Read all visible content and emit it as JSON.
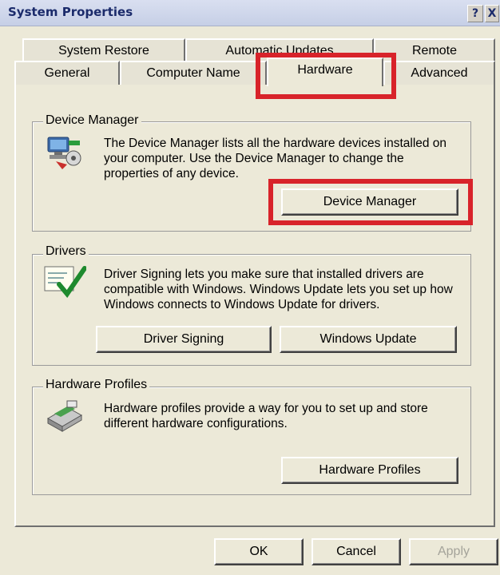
{
  "window": {
    "title": "System Properties",
    "help_btn": "?",
    "close_btn": "X"
  },
  "tabs": {
    "row1": [
      "System Restore",
      "Automatic Updates",
      "Remote"
    ],
    "row2": [
      "General",
      "Computer Name",
      "Hardware",
      "Advanced"
    ],
    "active": "Hardware"
  },
  "device_manager": {
    "title": "Device Manager",
    "desc": "The Device Manager lists all the hardware devices installed on your computer. Use the Device Manager to change the properties of any device.",
    "button": "Device Manager",
    "icon": "device-manager-icon"
  },
  "drivers": {
    "title": "Drivers",
    "desc": "Driver Signing lets you make sure that installed drivers are compatible with Windows. Windows Update lets you set up how Windows connects to Windows Update for drivers.",
    "btn_signing": "Driver Signing",
    "btn_update": "Windows Update",
    "icon": "driver-signing-icon"
  },
  "hardware_profiles": {
    "title": "Hardware Profiles",
    "desc": "Hardware profiles provide a way for you to set up and store different hardware configurations.",
    "button": "Hardware Profiles",
    "icon": "hardware-profiles-icon"
  },
  "footer": {
    "ok": "OK",
    "cancel": "Cancel",
    "apply": "Apply"
  },
  "colors": {
    "highlight": "#d8232a",
    "dialog_bg": "#ece9d8"
  }
}
